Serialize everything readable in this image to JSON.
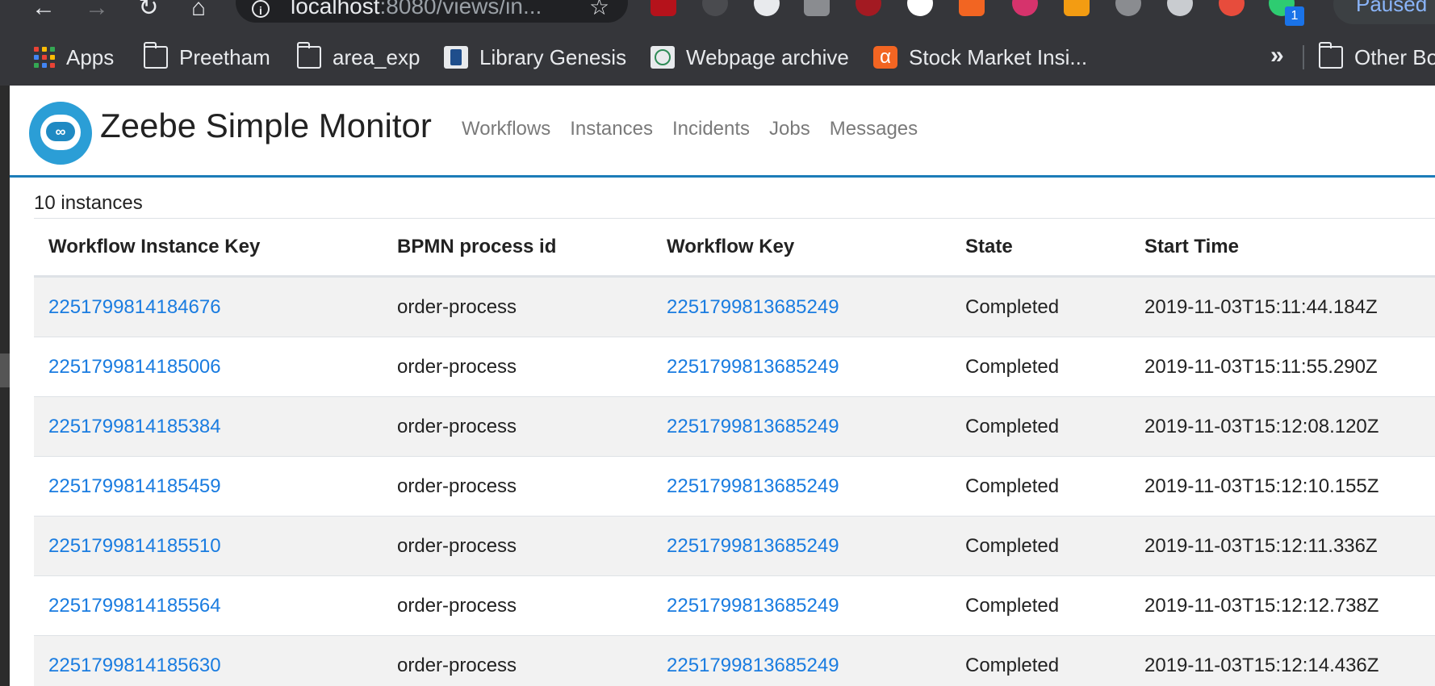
{
  "browser": {
    "url_host": "localhost",
    "url_rest": ":8080/views/in...",
    "profile_status": "Paused",
    "extension_badge": "1",
    "bookmarks": [
      {
        "label": "Apps",
        "icon": "apps-grid-icon"
      },
      {
        "label": "Preetham",
        "icon": "folder-icon"
      },
      {
        "label": "area_exp",
        "icon": "folder-icon"
      },
      {
        "label": "Library Genesis",
        "icon": "library-icon"
      },
      {
        "label": "Webpage archive",
        "icon": "globe-icon"
      },
      {
        "label": "Stock Market Insi...",
        "icon": "alpha-icon"
      },
      {
        "label": "Other Bo",
        "icon": "folder-icon"
      }
    ],
    "overflow_label": "»"
  },
  "app": {
    "title": "Zeebe Simple Monitor",
    "nav": [
      "Workflows",
      "Instances",
      "Incidents",
      "Jobs",
      "Messages"
    ],
    "brand_color": "#1c7cb8"
  },
  "instances": {
    "count_label": "10 instances",
    "columns": [
      "Workflow Instance Key",
      "BPMN process id",
      "Workflow Key",
      "State",
      "Start Time"
    ],
    "rows": [
      [
        "2251799814184676",
        "order-process",
        "2251799813685249",
        "Completed",
        "2019-11-03T15:11:44.184Z"
      ],
      [
        "2251799814185006",
        "order-process",
        "2251799813685249",
        "Completed",
        "2019-11-03T15:11:55.290Z"
      ],
      [
        "2251799814185384",
        "order-process",
        "2251799813685249",
        "Completed",
        "2019-11-03T15:12:08.120Z"
      ],
      [
        "2251799814185459",
        "order-process",
        "2251799813685249",
        "Completed",
        "2019-11-03T15:12:10.155Z"
      ],
      [
        "2251799814185510",
        "order-process",
        "2251799813685249",
        "Completed",
        "2019-11-03T15:12:11.336Z"
      ],
      [
        "2251799814185564",
        "order-process",
        "2251799813685249",
        "Completed",
        "2019-11-03T15:12:12.738Z"
      ],
      [
        "2251799814185630",
        "order-process",
        "2251799813685249",
        "Completed",
        "2019-11-03T15:12:14.436Z"
      ]
    ]
  }
}
